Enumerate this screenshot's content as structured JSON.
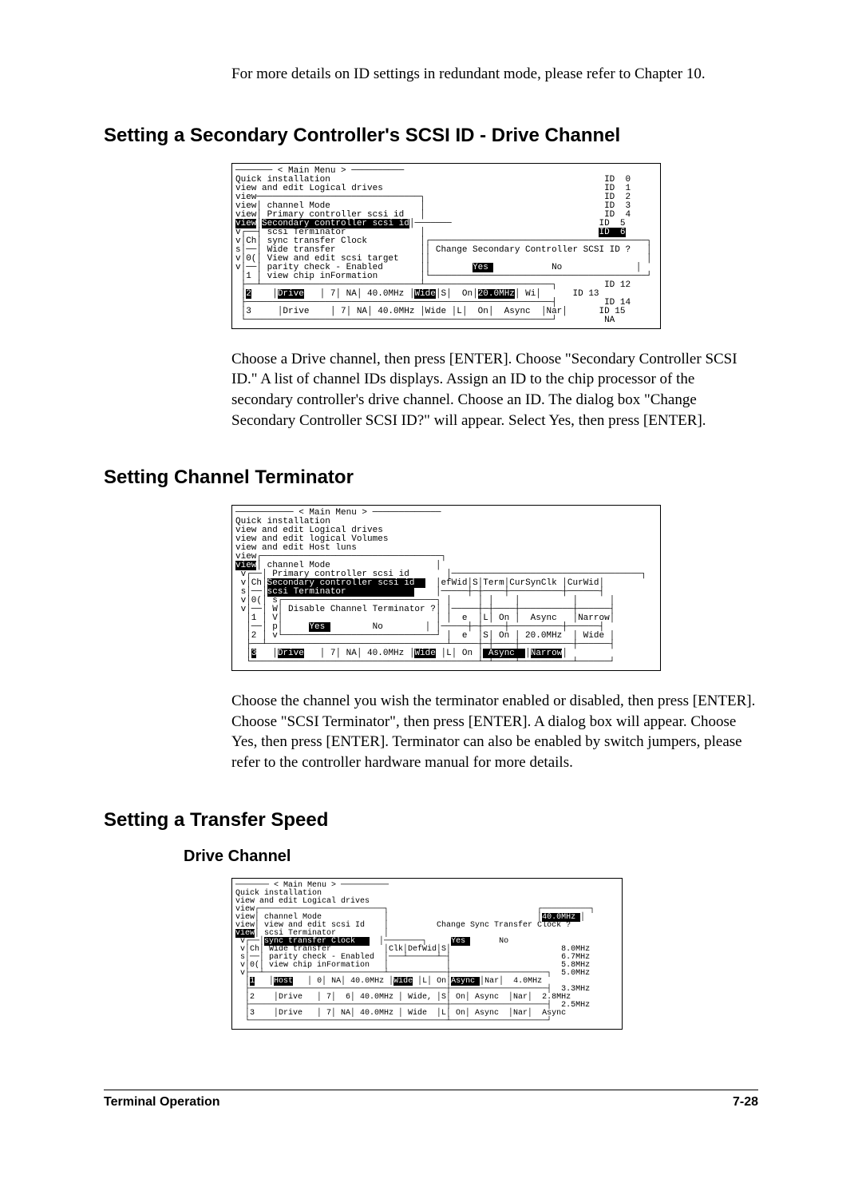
{
  "intro": "For more details on ID settings in redundant mode, please refer to Chapter 10.",
  "section1": {
    "heading": "Setting a Secondary Controller's SCSI ID - Drive Channel",
    "terminal": "─────── < Main Menu > ──────────                                                \nQuick installation                                                    ID  0     \nview and edit Logical drives                                          ID  1     \nview───────────────────────────────┐                                  ID  2     \nview│ channel Mode                 │                                  ID  3     \nview│ Primary controller scsi id   │                                  ID  4     \n[view]│[Secondary controller scsi id]│───────                            ID  5     \nv┌──┤ scsi Terminator              │                                 [ID  6]    \nv│Ch│ sync transfer Clock          │┌─────────────────────────────────────────┐\ns│──│ Wide transfer                ││ Change Secondary Controller SCSI ID ?   │\nv│0(│ View and edit scsi target    ││                                         │\nv│──│ parity check - Enabled       ││        [Yes ]           No              │\n │1 │ view chip inFormation        │└─────────────────────────────────────────┘\n ├──┴──────────────────────────────┴────────────────────────┐         ID 12     \n │[2]    │[Drive]   │ 7│ NA│ 40.0MHz │[Wide]│S│  On│[20.0MHz]│ Wi│      ID 13     \n ├──────────────────────────────────────────────────────────┤         ID 14     \n │3     │Drive    │ 7│ NA│ 40.0MHz │Wide │L│  On│  Async  │Nar│      ID 15     \n └──────────────────────────────────────────────────────────┘         NA        ",
    "body": "Choose a Drive channel, then press [ENTER].  Choose \"Secondary Controller SCSI ID.\"  A list of channel IDs displays.  Assign an ID to the chip processor of the secondary controller's drive channel.  Choose an ID.  The dialog box \"Change Secondary Controller SCSI ID?\" will appear.  Select Yes, then press [ENTER]."
  },
  "section2": {
    "heading": "Setting Channel Terminator",
    "terminal": "─────────── < Main Menu > ─────────────                                         \nQuick installation                                                              \nview and edit Logical drives                                                    \nview and edit logical Volumes                                                   \nview and edit Host luns                                                         \nview┌──────────────────────────────────┐                                        \n[view]│ channel Mode                    │                                        \n v┌──│ Primary controller scsi id       │────────────────────────────────────┐  \n v│Ch│[Secondary controller scsi id  ]  │efWid│S│Term│CurSynClk │CurWid│       \n s│──│[scsi Terminator             ]    │─────┼─┼────┼──────────┼──────┤       \n v│0(│ s┌─────────────────────────────┐ │     │ │    │          │      │       \n v│──│ W│ Disable Channel Terminator ?│ │─────┼─┼────┼──────────┼──────┤       \n  │1 │ V│                             │ │  e  │L│ On │  Async   │Narrow│       \n  │──│ p│     [Yes ]        No        │ │─────┼─┼────┼──────────┼──────┤       \n  │2 │ v└─────────────────────────────┘ │  e  │S│ On │ 20.0MHz  │ Wide │       \n  ├──┴──────────────────────────────────┴─────┼─┼────┼──────────┼──────┤       \n  │[3]   │[Drive]   │ 7│ NA│ 40.0MHz │[Wide] │L│ On │[ Async  ]│[Narrow]│       \n  └───────────────────────────────────────────┴─┴────┴──────────┴──────┘       ",
    "body": "Choose the channel you wish the terminator enabled or disabled, then press [ENTER]. Choose \"SCSI Terminator\", then press [ENTER]. A dialog box will appear. Choose Yes, then press [ENTER]. Terminator can also be enabled by switch jumpers, please refer to the controller hardware manual for more details."
  },
  "section3": {
    "heading": "Setting a Transfer Speed",
    "subheading": "Drive Channel",
    "terminal": "─────── < Main Menu > ──────────                                               \nQuick installation                                                             \nview and edit Logical drives                                                   \nview┌──────────────────────────┐                               ┌──────────┐    \nview│ channel Mode             │                               │[40.0MHz ]│    \nview│ view and edit scsi Id    │          Change Sync Transfer Clock ?         \n[view]│ scsi Terminator          │                                               \n v┌──│[sync transfer Clock   ]  │────────┐     [Yes ]      No                   \n v│Ch│ Wide transfer           │Clk│DefWid│S│                       8.0MHz      \n s│──│ parity check - Enabled  │───┴──────┴─┤                       6.7MHz      \n v│0(│ view chip inFormation   │            │                       5.8MHz      \n v├──┴─────────────────────────┴────────────┼────────────────────┐  5.0MHz      \n  │[1]   │[Host]   │ 0│ NA│ 40.0MHz │[Wide] │L│ On│[Async ]│Nar│  4.0MHz      \n  ├─────────────────────────────────────────┼────────────────────┤  3.3MHz      \n  │2    │Drive   │ 7│  6│ 40.0MHz │ Wide, │S│ On│ Async  │Nar│  2.8MHz      \n  ├─────────────────────────────────────────┼────────────────────┤  2.5MHz      \n  │3    │Drive   │ 7│ NA│ 40.0MHz │ Wide  │L│ On│ Async  │Nar│  Async       \n  └─────────────────────────────────────────┴────────────────────┘             "
  },
  "footer": {
    "left": "Terminal Operation",
    "right": "7-28"
  }
}
